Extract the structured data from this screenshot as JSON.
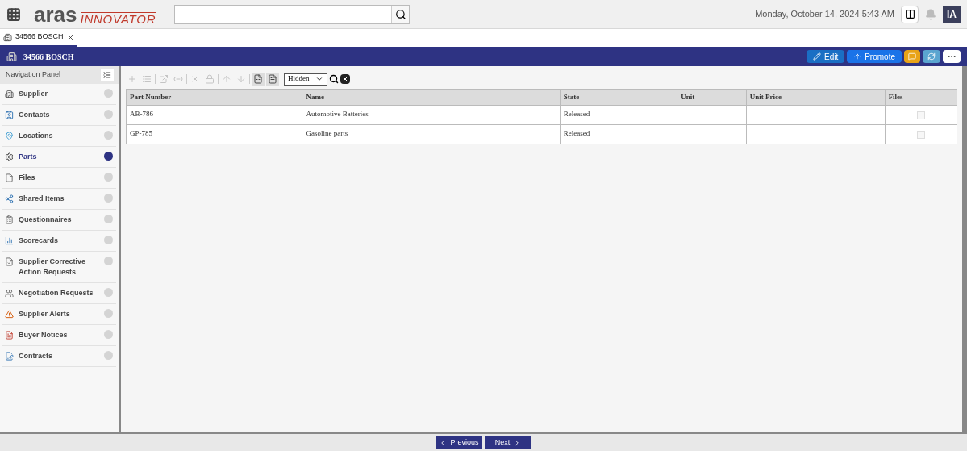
{
  "header": {
    "logo_main": "aras",
    "logo_sub": "INNOVATOR",
    "datetime": "Monday, October 14, 2024 5:43 AM",
    "avatar": "IA"
  },
  "tabs": [
    {
      "label": "34566 BOSCH",
      "selected": true
    }
  ],
  "title_bar": {
    "title": "34566 BOSCH",
    "actions": [
      {
        "kind": "edit",
        "label": "Edit"
      },
      {
        "kind": "promote",
        "label": "Promote"
      },
      {
        "kind": "comment"
      },
      {
        "kind": "refresh"
      },
      {
        "kind": "more"
      }
    ]
  },
  "nav": {
    "title": "Navigation Panel",
    "items": [
      {
        "label": "Supplier",
        "selected": false
      },
      {
        "label": "Contacts",
        "selected": false
      },
      {
        "label": "Locations",
        "selected": false
      },
      {
        "label": "Parts",
        "selected": true
      },
      {
        "label": "Files",
        "selected": false
      },
      {
        "label": "Shared Items",
        "selected": false
      },
      {
        "label": "Questionnaires",
        "selected": false
      },
      {
        "label": "Scorecards",
        "selected": false
      },
      {
        "label": "Supplier Corrective Action Requests",
        "selected": false
      },
      {
        "label": "Negotiation Requests",
        "selected": false
      },
      {
        "label": "Supplier Alerts",
        "selected": false
      },
      {
        "label": "Buyer Notices",
        "selected": false
      },
      {
        "label": "Contracts",
        "selected": false
      }
    ]
  },
  "toolbar": {
    "filter": "Hidden"
  },
  "table": {
    "columns": [
      "Part Number",
      "Name",
      "State",
      "Unit",
      "Unit Price",
      "Files"
    ],
    "rows": [
      {
        "cells": [
          "AB-786",
          "Automotive Batteries",
          "Released"
        ],
        "files_checked": false
      },
      {
        "cells": [
          "GP-785",
          "Gasoline parts",
          "Released"
        ],
        "files_checked": false
      }
    ]
  },
  "pager": {
    "previous": "Previous",
    "next": "Next"
  }
}
